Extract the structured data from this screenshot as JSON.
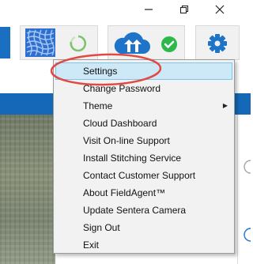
{
  "window": {
    "minimize_icon": "minimize-icon",
    "restore_icon": "restore-icon",
    "close_icon": "close-icon"
  },
  "toolbar": {
    "buttons": [
      {
        "name": "stitch-grid-icon"
      },
      {
        "name": "sync-progress-icon"
      },
      {
        "name": "cloud-upload-icon"
      },
      {
        "name": "status-ok-icon"
      },
      {
        "name": "settings-gear-icon"
      }
    ]
  },
  "menu": {
    "items": [
      {
        "label": "Settings",
        "selected": true
      },
      {
        "label": "Change Password"
      },
      {
        "label": "Theme",
        "has_submenu": true
      },
      {
        "label": "Cloud Dashboard"
      },
      {
        "label": "Visit On-line Support"
      },
      {
        "label": "Install Stitching Service"
      },
      {
        "label": "Contact Customer Support"
      },
      {
        "label": "About FieldAgent™"
      },
      {
        "label": "Update Sentera Camera"
      },
      {
        "label": "Sign Out"
      },
      {
        "label": "Exit"
      }
    ]
  },
  "colors": {
    "accent_blue": "#1568b8",
    "menu_selected_bg": "#cde8f6",
    "highlight_circle": "#e04a45",
    "status_green": "#2db84a"
  }
}
